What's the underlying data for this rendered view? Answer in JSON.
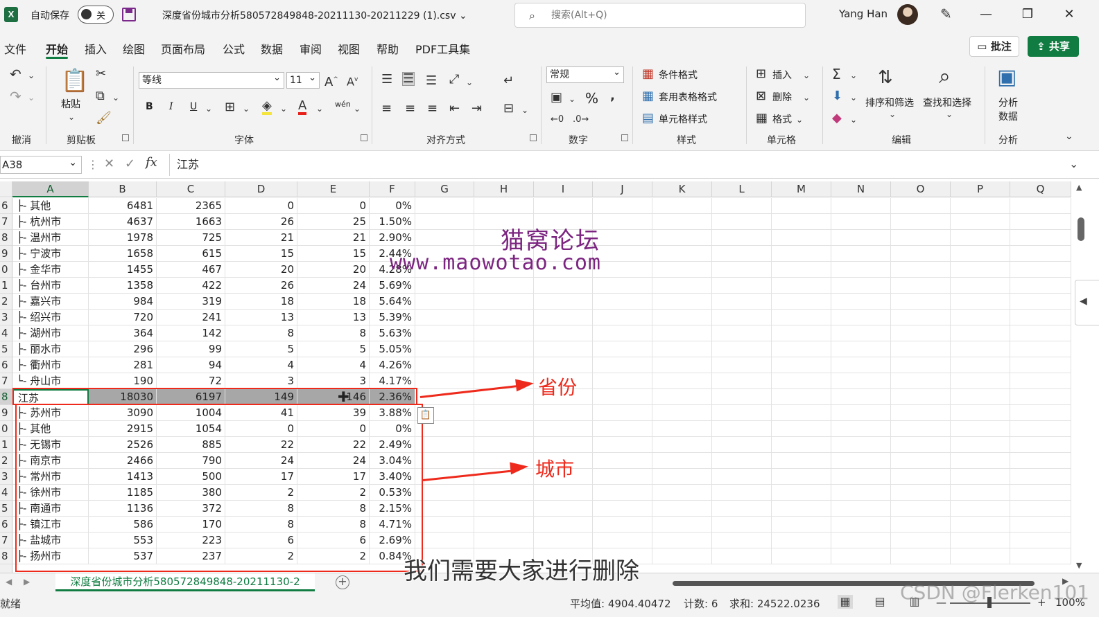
{
  "titlebar": {
    "app_icon": "X",
    "autosave_label": "自动保存",
    "autosave_state": "关",
    "doc_title": "深度省份城市分析580572849848-20211130-20211229 (1).csv",
    "search_placeholder": "搜索(Alt+Q)",
    "user_name": "Yang Han",
    "minimize": "—",
    "restore": "❐",
    "close": "✕"
  },
  "menu": {
    "items": [
      "文件",
      "开始",
      "插入",
      "绘图",
      "页面布局",
      "公式",
      "数据",
      "审阅",
      "视图",
      "帮助",
      "PDF工具集"
    ],
    "active_index": 1,
    "comment_button": "批注",
    "share_button": "共享"
  },
  "ribbon": {
    "groups": {
      "undo": "撤消",
      "clipboard": "剪贴板",
      "font": "字体",
      "alignment": "对齐方式",
      "number": "数字",
      "styles": "样式",
      "cells": "单元格",
      "editing": "编辑",
      "analysis": "分析"
    },
    "paste": "粘贴",
    "font_name": "等线",
    "font_size": "11",
    "number_format": "常规",
    "conditional_format": "条件格式",
    "table_format": "套用表格格式",
    "cell_style": "单元格样式",
    "insert": "插入",
    "delete": "删除",
    "format": "格式",
    "sort_filter": "排序和筛选",
    "find_select": "查找和选择",
    "analyze_line1": "分析",
    "analyze_line2": "数据",
    "wen": "wén",
    "bold": "B",
    "italic": "I",
    "underline": "U",
    "percent": "%"
  },
  "formula_bar": {
    "name_box": "A38",
    "fx": "fx",
    "content": "江苏"
  },
  "columns": [
    "A",
    "B",
    "C",
    "D",
    "E",
    "F",
    "G",
    "H",
    "I",
    "J",
    "K",
    "L",
    "M",
    "N",
    "O",
    "P",
    "Q"
  ],
  "rows": [
    {
      "num": "6",
      "a": "├- 其他",
      "b": "6481",
      "c": "2365",
      "d": "0",
      "e": "0",
      "f": "0%"
    },
    {
      "num": "7",
      "a": "├- 杭州市",
      "b": "4637",
      "c": "1663",
      "d": "26",
      "e": "25",
      "f": "1.50%"
    },
    {
      "num": "8",
      "a": "├- 温州市",
      "b": "1978",
      "c": "725",
      "d": "21",
      "e": "21",
      "f": "2.90%"
    },
    {
      "num": "9",
      "a": "├- 宁波市",
      "b": "1658",
      "c": "615",
      "d": "15",
      "e": "15",
      "f": "2.44%"
    },
    {
      "num": "0",
      "a": "├- 金华市",
      "b": "1455",
      "c": "467",
      "d": "20",
      "e": "20",
      "f": "4.28%"
    },
    {
      "num": "1",
      "a": "├- 台州市",
      "b": "1358",
      "c": "422",
      "d": "26",
      "e": "24",
      "f": "5.69%"
    },
    {
      "num": "2",
      "a": "├- 嘉兴市",
      "b": "984",
      "c": "319",
      "d": "18",
      "e": "18",
      "f": "5.64%"
    },
    {
      "num": "3",
      "a": "├- 绍兴市",
      "b": "720",
      "c": "241",
      "d": "13",
      "e": "13",
      "f": "5.39%"
    },
    {
      "num": "4",
      "a": "├- 湖州市",
      "b": "364",
      "c": "142",
      "d": "8",
      "e": "8",
      "f": "5.63%"
    },
    {
      "num": "5",
      "a": "├- 丽水市",
      "b": "296",
      "c": "99",
      "d": "5",
      "e": "5",
      "f": "5.05%"
    },
    {
      "num": "6",
      "a": "├- 衢州市",
      "b": "281",
      "c": "94",
      "d": "4",
      "e": "4",
      "f": "4.26%"
    },
    {
      "num": "7",
      "a": "└- 舟山市",
      "b": "190",
      "c": "72",
      "d": "3",
      "e": "3",
      "f": "4.17%"
    },
    {
      "num": "8",
      "a": "江苏",
      "b": "18030",
      "c": "6197",
      "d": "149",
      "e": "146",
      "f": "2.36%",
      "selected": true
    },
    {
      "num": "9",
      "a": "├- 苏州市",
      "b": "3090",
      "c": "1004",
      "d": "41",
      "e": "39",
      "f": "3.88%"
    },
    {
      "num": "0",
      "a": "├- 其他",
      "b": "2915",
      "c": "1054",
      "d": "0",
      "e": "0",
      "f": "0%"
    },
    {
      "num": "1",
      "a": "├- 无锡市",
      "b": "2526",
      "c": "885",
      "d": "22",
      "e": "22",
      "f": "2.49%"
    },
    {
      "num": "2",
      "a": "├- 南京市",
      "b": "2466",
      "c": "790",
      "d": "24",
      "e": "24",
      "f": "3.04%"
    },
    {
      "num": "3",
      "a": "├- 常州市",
      "b": "1413",
      "c": "500",
      "d": "17",
      "e": "17",
      "f": "3.40%"
    },
    {
      "num": "4",
      "a": "├- 徐州市",
      "b": "1185",
      "c": "380",
      "d": "2",
      "e": "2",
      "f": "0.53%"
    },
    {
      "num": "5",
      "a": "├- 南通市",
      "b": "1136",
      "c": "372",
      "d": "8",
      "e": "8",
      "f": "2.15%"
    },
    {
      "num": "6",
      "a": "├- 镇江市",
      "b": "586",
      "c": "170",
      "d": "8",
      "e": "8",
      "f": "4.71%"
    },
    {
      "num": "7",
      "a": "├- 盐城市",
      "b": "553",
      "c": "223",
      "d": "6",
      "e": "6",
      "f": "2.69%"
    },
    {
      "num": "8",
      "a": "├- 扬州市",
      "b": "537",
      "c": "237",
      "d": "2",
      "e": "2",
      "f": "0.84%"
    }
  ],
  "watermark": {
    "line1": "猫窝论坛",
    "line2": "www.maowotao.com"
  },
  "annotations": {
    "province": "省份",
    "city": "城市"
  },
  "sheet": {
    "tab_name": "深度省份城市分析580572849848-20211130-2",
    "add": "+"
  },
  "subtitle": "我们需要大家进行删除",
  "status": {
    "ready": "就绪",
    "average": "平均值: 4904.40472",
    "count": "计数: 6",
    "sum": "求和: 24522.0236",
    "zoom": "100%",
    "zoom_minus": "—",
    "zoom_plus": "+",
    "credit": "CSDN @Flerken101"
  },
  "colors": {
    "accent": "#107c41",
    "annotation": "#ee2a1c",
    "watermark": "#7b2480"
  }
}
